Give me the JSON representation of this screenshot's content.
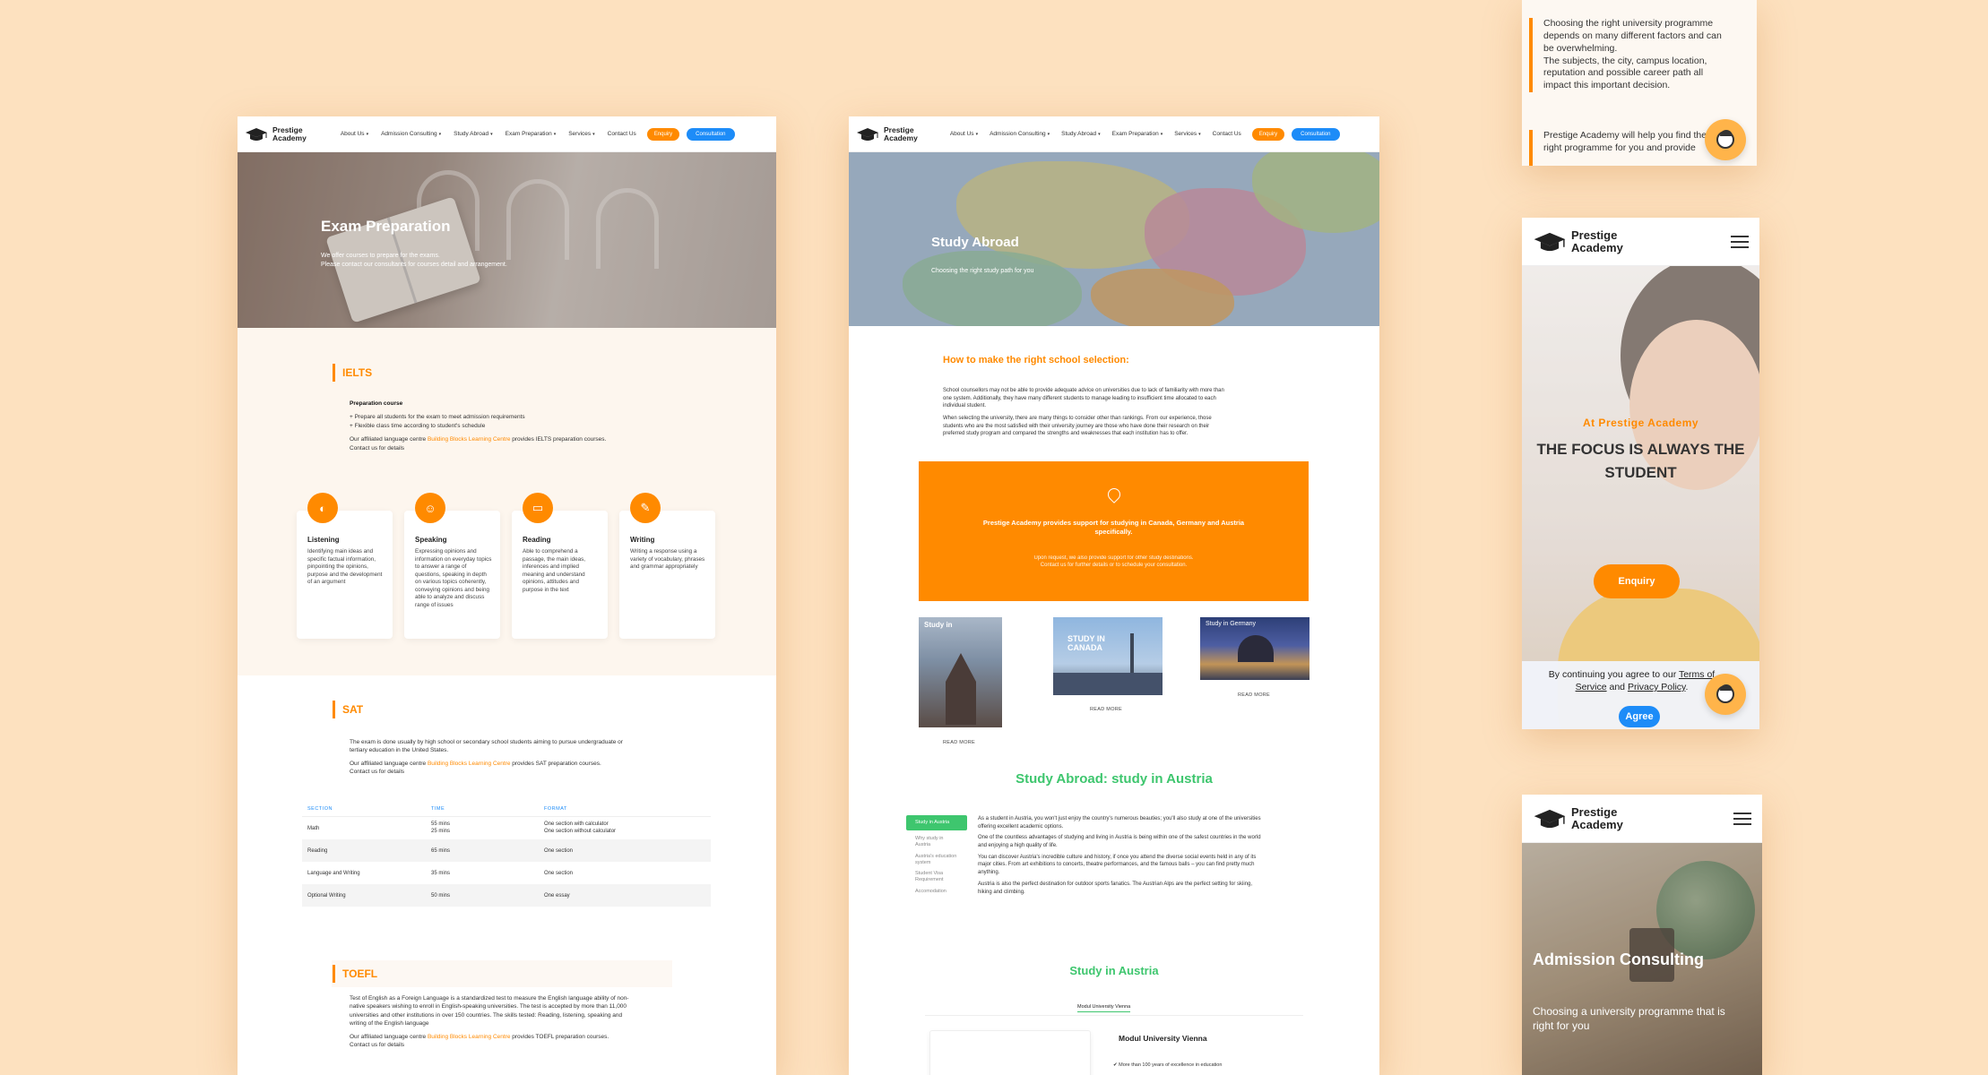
{
  "brand": {
    "name_line1": "Prestige",
    "name_line2": "Academy"
  },
  "nav": {
    "links": [
      "About Us",
      "Admission Consulting",
      "Study Abroad",
      "Exam Preparation",
      "Services",
      "Contact Us"
    ],
    "enquiry": "Enquiry",
    "consultation": "Consultation"
  },
  "exam_page": {
    "hero_title": "Exam Preparation",
    "hero_sub1": "We offer courses to prepare for the exams.",
    "hero_sub2": "Please contact our consultants for courses detail and arrangement.",
    "ielts": {
      "heading": "IELTS",
      "course_label": "Preparation course",
      "bullet1": "+ Prepare all students for the exam to meet admission requirements",
      "bullet2": "+ Flexible class time according to student's schedule",
      "affiliate_pre": "Our affiliated language centre ",
      "affiliate_link": "Building Blocks Learning Centre",
      "affiliate_post": " provides IELTS preparation courses.",
      "contact": "Contact us for details",
      "skills": [
        {
          "title": "Listening",
          "desc": "Identifying main ideas and specific factual information, pinpointing the opinions, purpose and the development of an argument"
        },
        {
          "title": "Speaking",
          "desc": "Expressing opinions and information on everyday topics to answer a range of questions, speaking in depth on various topics coherently, conveying opinions and being able to analyze and discuss range of issues"
        },
        {
          "title": "Reading",
          "desc": "Able to comprehend a passage, the main ideas, inferences and implied meaning and understand opinions, attitudes and purpose in the text"
        },
        {
          "title": "Writing",
          "desc": "Writing a response using a variety of vocabulary, phrases and grammar appropriately"
        }
      ]
    },
    "sat": {
      "heading": "SAT",
      "desc1": "The exam is done usually by high school or secondary school students aiming to pursue undergraduate or",
      "desc2": "tertiary education in the United States.",
      "affiliate_pre": "Our affiliated language centre ",
      "affiliate_link": "Building Blocks Learning Centre",
      "affiliate_post": " provides SAT preparation courses.",
      "contact": "Contact us for details",
      "table": {
        "headers": [
          "SECTION",
          "TIME",
          "FORMAT"
        ],
        "rows": [
          {
            "section": "Math",
            "time1": "55 mins",
            "time2": "25 mins",
            "format1": "One section with calculator",
            "format2": "One section without calculator"
          },
          {
            "section": "Reading",
            "time1": "65 mins",
            "time2": "",
            "format1": "One section",
            "format2": ""
          },
          {
            "section": "Language and Writing",
            "time1": "35 mins",
            "time2": "",
            "format1": "One section",
            "format2": ""
          },
          {
            "section": "Optional Writing",
            "time1": "50 mins",
            "time2": "",
            "format1": "One essay",
            "format2": ""
          }
        ]
      }
    },
    "toefl": {
      "heading": "TOEFL",
      "desc1": "Test of English as a Foreign Language is a standardized test to measure the English language ability of non-",
      "desc2": "native speakers wishing to enroll in English-speaking universities. The test is accepted by more than 11,000",
      "desc3": "universities and other institutions in over 150 countries. The skills tested: Reading, listening, speaking and",
      "desc4": "writing of the English language",
      "affiliate_pre": "Our affiliated language centre ",
      "affiliate_link": "Building Blocks Learning Centre",
      "affiliate_post": " provides TOEFL preparation courses.",
      "contact": "Contact us for details"
    }
  },
  "abroad_page": {
    "hero_title": "Study Abroad",
    "hero_sub": "Choosing the right study path for you",
    "selection_heading": "How to make the right school selection:",
    "para1_l1": "School counsellors may not be able to provide adequate advice on universities due to lack of familiarity with more than",
    "para1_l2": "one system. Additionally, they have many different students to manage leading to insufficient time allocated to each",
    "para1_l3": "individual student.",
    "para2_l1": "When selecting the university, there are many things to consider other than rankings. From our experience, those",
    "para2_l2": "students who are the most satisfied with their university journey are those who have done their research on their",
    "para2_l3": "preferred study program and compared the strengths and weaknesses that each institution has to offer.",
    "orange_main": "Prestige Academy provides support for studying in Canada, Germany and Austria specifically.",
    "orange_sub1": "Upon request, we also provide support for other study destinations.",
    "orange_sub2": "Contact us for further details or to schedule your consultation.",
    "countries": [
      {
        "label": "Study in",
        "readmore": "READ MORE"
      },
      {
        "label": "STUDY IN CANADA",
        "readmore": "READ MORE"
      },
      {
        "label": "Study in Germany",
        "readmore": "READ MORE"
      }
    ],
    "austria_heading": "Study Abroad: study in Austria",
    "side_tabs": [
      "Study in Austria",
      "Why study in Austria",
      "Austria's education system",
      "Student Visa Requirement",
      "Accomodation"
    ],
    "austria_p1_l1": "As a student in Austria, you won't just enjoy the country's numerous beauties; you'll also study at one of the universities",
    "austria_p1_l2": "offering excellent academic options.",
    "austria_p2_l1": "One of the countless advantages of studying and living in Austria is being within one of the safest countries in the world",
    "austria_p2_l2": "and enjoying a high quality of life.",
    "austria_p3_l1": "You can discover Austria's incredible culture and history, if once you attend the diverse social events held in any of its",
    "austria_p3_l2": "major cities. From art exhibitions to concerts, theatre performances, and the famous balls – you can find pretty much",
    "austria_p3_l3": "anything.",
    "austria_p4_l1": "Austria is also the perfect destination for outdoor sports fanatics. The Austrian Alps are the perfect setting for skiing,",
    "austria_p4_l2": "hiking and climbing.",
    "study_austria_heading": "Study in Austria",
    "uni_tab": "Modul University Vienna",
    "uni_name": "Modul University Vienna",
    "uni_bullet": "✔ More than 100 years of excellence in education"
  },
  "mobile_quote": {
    "line1": "Choosing the right university programme",
    "line2": "depends on many different factors and can",
    "line3": "be overwhelming.",
    "line4": "The subjects, the city, campus location,",
    "line5": "reputation and possible career path all",
    "line6": "impact this important decision.",
    "line7": "Prestige Academy will help you find the",
    "line8": "right programme for you and provide"
  },
  "mobile_home": {
    "kicker": "At Prestige Academy",
    "title_l1": "THE FOCUS IS ALWAYS THE",
    "title_l2": "STUDENT",
    "enquiry": "Enquiry",
    "cookie_pre": "By continuing you agree to our ",
    "cookie_terms": "Terms of Service",
    "cookie_and": " and ",
    "cookie_privacy": "Privacy Policy",
    "cookie_end": ".",
    "agree": "Agree"
  },
  "mobile_admission": {
    "title": "Admission Consulting",
    "sub": "Choosing a university programme that is right for you"
  },
  "colors": {
    "accent": "#ff8a00",
    "primary_blue": "#1d8cf8",
    "green": "#3ec66e",
    "background": "#fde1bf"
  },
  "icons": [
    "graduation-cap-icon",
    "chevron-down-icon",
    "ear-icon",
    "speech-icon",
    "book-icon",
    "pen-icon",
    "location-pin-icon",
    "hamburger-menu-icon",
    "chatbot-icon"
  ]
}
